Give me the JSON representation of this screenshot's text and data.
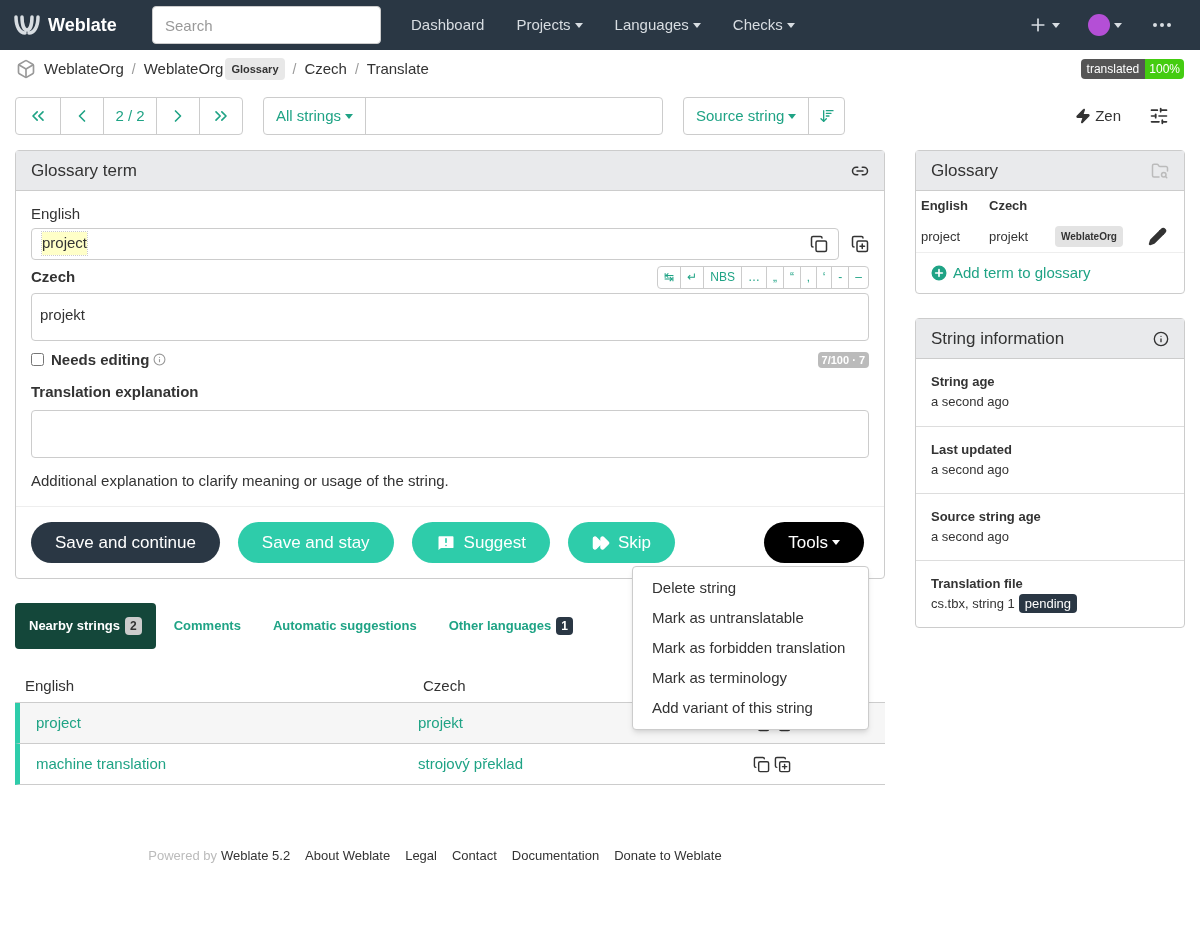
{
  "navbar": {
    "brand": "Weblate",
    "search": {
      "placeholder": "Search"
    },
    "items": [
      {
        "label": "Dashboard",
        "dropdown": false
      },
      {
        "label": "Projects",
        "dropdown": true
      },
      {
        "label": "Languages",
        "dropdown": true
      },
      {
        "label": "Checks",
        "dropdown": true
      }
    ]
  },
  "breadcrumb": {
    "separator": "/",
    "items": [
      {
        "label": "WeblateOrg"
      },
      {
        "label": "WeblateOrg",
        "badge": "Glossary"
      },
      {
        "label": "Czech"
      },
      {
        "label": "Translate"
      }
    ],
    "status": {
      "label": "translated",
      "value": "100%"
    }
  },
  "toolbar": {
    "position": "2 / 2",
    "filter": "All strings",
    "sort": "Source string",
    "zen": "Zen"
  },
  "editor": {
    "title": "Glossary term",
    "source_label": "English",
    "source": "project",
    "target_label": "Czech",
    "target": "projekt",
    "special_chars": [
      "↹",
      "↵",
      "NBS",
      "…",
      "„",
      "“",
      "‚",
      "‘",
      "-",
      "–"
    ],
    "needs_editing": {
      "label": "Needs editing",
      "checked": false
    },
    "counter": "7/100 · 7",
    "explanation_label": "Translation explanation",
    "explanation_help": "Additional explanation to clarify meaning or usage of the string.",
    "buttons": [
      {
        "label": "Save and continue",
        "kind": "primary"
      },
      {
        "label": "Save and stay",
        "kind": "secondary"
      },
      {
        "label": "Suggest",
        "kind": "suggest"
      },
      {
        "label": "Skip",
        "kind": "skip"
      }
    ],
    "tools": "Tools"
  },
  "tools_menu": [
    "Delete string",
    "Mark as untranslatable",
    "Mark as forbidden translation",
    "Mark as terminology",
    "Add variant of this string"
  ],
  "tabs": [
    {
      "label": "Nearby strings",
      "badge": "2",
      "selected": true
    },
    {
      "label": "Comments",
      "selected": false
    },
    {
      "label": "Automatic suggestions",
      "selected": false
    },
    {
      "label": "Other languages",
      "badge": "1",
      "selected": false
    }
  ],
  "nearby": {
    "columns": [
      "English",
      "Czech"
    ],
    "rows": [
      {
        "source": "project",
        "target": "projekt"
      },
      {
        "source": "machine translation",
        "target": "strojový překlad"
      }
    ]
  },
  "glossary": {
    "title": "Glossary",
    "columns": [
      "English",
      "Czech"
    ],
    "rows": [
      {
        "source": "project",
        "target": "projekt",
        "tag": "WeblateOrg"
      }
    ],
    "add": "Add term to glossary"
  },
  "string_info": {
    "title": "String information",
    "items": [
      {
        "label": "String age",
        "value": "a second ago"
      },
      {
        "label": "Last updated",
        "value": "a second ago"
      },
      {
        "label": "Source string age",
        "value": "a second ago"
      },
      {
        "label": "Translation file",
        "value": "cs.tbx, string 1",
        "badge": "pending"
      }
    ]
  },
  "footer": {
    "powered": "Powered by",
    "links": [
      "Weblate 5.2",
      "About Weblate",
      "Legal",
      "Contact",
      "Documentation",
      "Donate to Weblate"
    ]
  }
}
